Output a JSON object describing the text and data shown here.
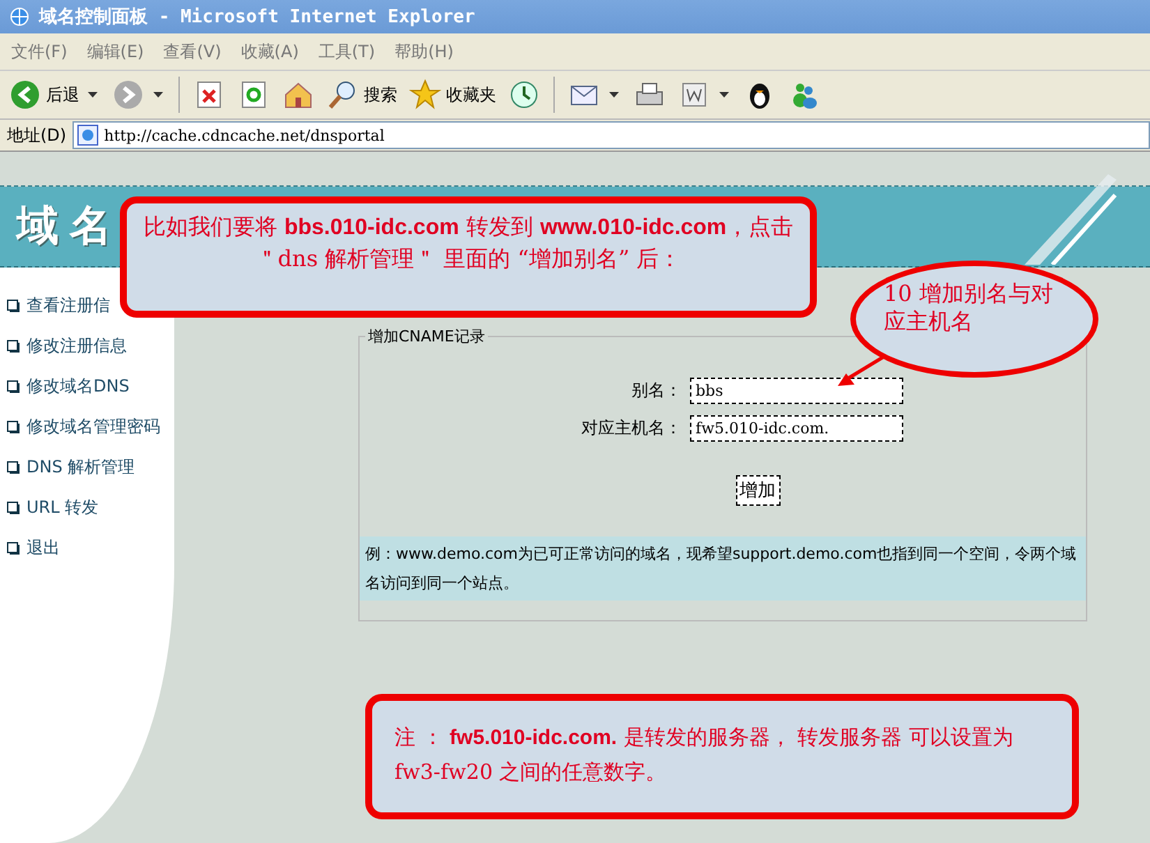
{
  "window": {
    "title": "域名控制面板 - Microsoft Internet Explorer"
  },
  "menu": [
    "文件(F)",
    "编辑(E)",
    "查看(V)",
    "收藏(A)",
    "工具(T)",
    "帮助(H)"
  ],
  "toolbar": [
    {
      "kind": "back",
      "label": "后退",
      "dropdown": true
    },
    {
      "kind": "forward",
      "dropdown": true
    },
    {
      "kind": "stop"
    },
    {
      "kind": "refresh"
    },
    {
      "kind": "home"
    },
    {
      "kind": "search",
      "label": "搜索"
    },
    {
      "kind": "favorites",
      "label": "收藏夹"
    },
    {
      "kind": "history"
    },
    {
      "kind": "mail",
      "dropdown": true
    },
    {
      "kind": "print"
    },
    {
      "kind": "edit",
      "dropdown": true
    },
    {
      "kind": "penguin"
    },
    {
      "kind": "messenger"
    }
  ],
  "address_bar": {
    "label": "地址(D)",
    "url": "http://cache.cdncache.net/dnsportal"
  },
  "page": {
    "header_title": "域名",
    "sidebar": [
      "查看注册信",
      "修改注册信息",
      "修改域名DNS",
      "修改域名管理密码",
      "DNS 解析管理",
      "URL 转发",
      "退出"
    ],
    "form": {
      "legend": "增加CNAME记录",
      "fields": [
        {
          "label": "别名：",
          "value": "bbs"
        },
        {
          "label": "对应主机名：",
          "value": "fw5.010-idc.com."
        }
      ],
      "submit": "增加",
      "example": "例：www.demo.com为已可正常访问的域名，现希望support.demo.com也指到同一个空间，令两个域名访问到同一个站点。"
    }
  },
  "annotations": [
    {
      "kind": "box",
      "text": "比如我们要将 **bbs.010-idc.com** 转发到 **www.010-idc.com**，点击＂dns 解析管理＂ 里面的 “增加别名” 后："
    },
    {
      "kind": "ellipse",
      "text": "10 增加别名与对应主机名"
    },
    {
      "kind": "note",
      "text": "注 ： **fw5.010-idc.com.** 是转发的服务器，  转发服务器 可以设置为 fw3-fw20 之间的任意数字。"
    }
  ]
}
